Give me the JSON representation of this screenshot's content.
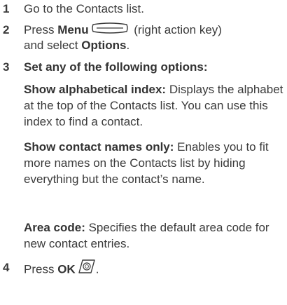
{
  "steps": [
    {
      "number": "1",
      "text": "Go to the Contacts list."
    },
    {
      "number": "2",
      "prefix": "Press ",
      "menu_label": "Menu",
      "menu_key_icon": "right-action-key-icon",
      "after_key": " (right action key)",
      "line2_prefix": "and select ",
      "options_label": "Options",
      "line2_suffix": "."
    },
    {
      "number": "3",
      "heading": "Set any of the following options:",
      "options": [
        {
          "term": "Show alphabetical index:",
          "description": " Displays the alphabet at the top of the Contacts list. You can use this index to find a contact."
        },
        {
          "term": "Show contact names only:",
          "description": " Enables you to fit more names on the Contacts list by hiding everything but the contact’s name."
        },
        {
          "term": "Area code:",
          "description": " Specifies the default area code for new contact entries."
        }
      ]
    },
    {
      "number": "4",
      "prefix": "Press ",
      "ok_label": "OK",
      "ok_key_icon": "ok-key-icon",
      "suffix": "."
    }
  ]
}
